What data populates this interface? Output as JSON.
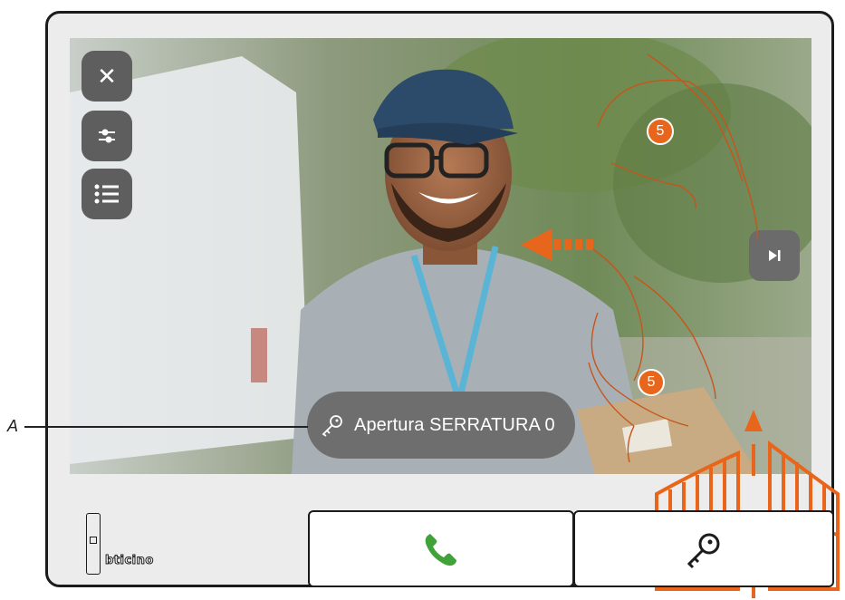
{
  "lock_button": {
    "label": "Apertura SERRATURA 0",
    "icon": "key-icon"
  },
  "side_buttons": [
    {
      "name": "close-button",
      "icon": "close-icon",
      "glyph": "✕"
    },
    {
      "name": "settings-button",
      "icon": "sliders-icon"
    },
    {
      "name": "list-button",
      "icon": "list-icon"
    }
  ],
  "skip_button": {
    "icon": "skip-next-icon"
  },
  "bottom_buttons": {
    "answer": {
      "icon": "phone-icon"
    },
    "door_lock": {
      "icon": "key-icon"
    }
  },
  "brand": {
    "logo_text": "bticino"
  },
  "annotations": {
    "callout_letter": "A",
    "step_top": "5",
    "step_bottom": "5",
    "accent_color": "#e8661b"
  }
}
